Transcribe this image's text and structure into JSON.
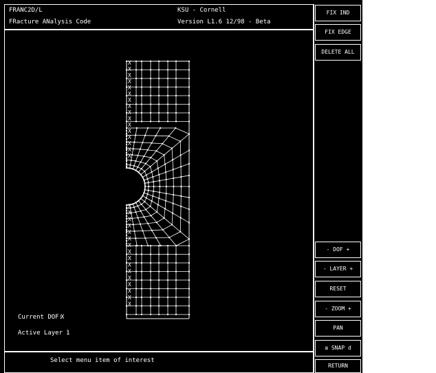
{
  "header": {
    "app_name": "FRANC2D/L",
    "app_subtitle": "FRacture ANalysis Code",
    "org": "KSU - Cornell",
    "version": "Version L1.6 12/98 - Beta"
  },
  "menu": {
    "fix_ind": "FIX IND",
    "fix_edge": "FIX EDGE",
    "delete_all": "DELETE ALL",
    "dof": "- DOF +",
    "layer": "- LAYER +",
    "reset": "RESET",
    "zoom": "- ZOOM +",
    "pan": "PAN",
    "snap": "a SNAP d",
    "return": "RETURN"
  },
  "status": {
    "current_dof_label": "Current DOF:",
    "current_dof_value": "X",
    "active_layer_label": "Active Layer :",
    "active_layer_value": "1"
  },
  "prompt": {
    "text": "Select menu item of interest"
  },
  "mesh": {
    "constraint_marker": "X",
    "constraint_count_top": 16,
    "constraint_count_bottom": 16
  },
  "colors": {
    "background": "#000000",
    "foreground": "#ffffff",
    "page": "#ffffff"
  }
}
